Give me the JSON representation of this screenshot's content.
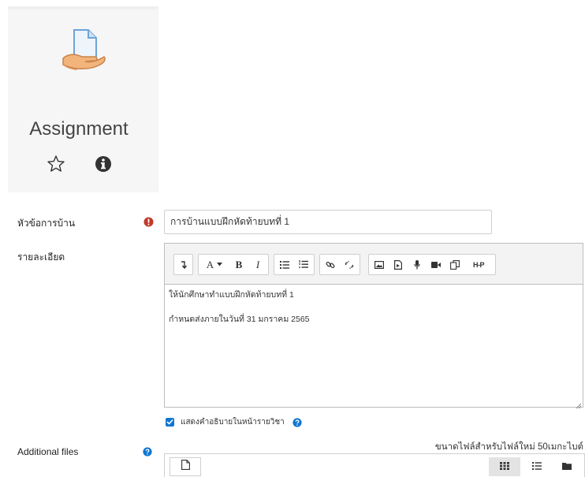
{
  "activity": {
    "title": "Assignment"
  },
  "form": {
    "name_label": "หัวข้อการบ้าน",
    "name_value": "การบ้านแบบฝึกหัดท้ายบทที่ 1",
    "description_label": "รายละเอียด",
    "description_lines": [
      "ให้นักศึกษาทำแบบฝึกหัดท้ายบทที่ 1",
      "กำหนดส่งภายในวันที่ 31 มกราคม 2565"
    ],
    "show_description_label": "แสดงคำอธิบายในหน้ารายวิชา",
    "show_description_checked": true,
    "additional_files_label": "Additional files",
    "max_file_size_text": "ขนาดไฟล์สำหรับไฟล์ใหม่ 50เมกะไบต์"
  },
  "toolbar": {
    "font_label": "A",
    "bold_label": "B",
    "italic_label": "I",
    "h5p_label": "H-P"
  },
  "colors": {
    "accent": "#1177d1",
    "required": "#c0392b",
    "icon_dark": "#333333"
  }
}
